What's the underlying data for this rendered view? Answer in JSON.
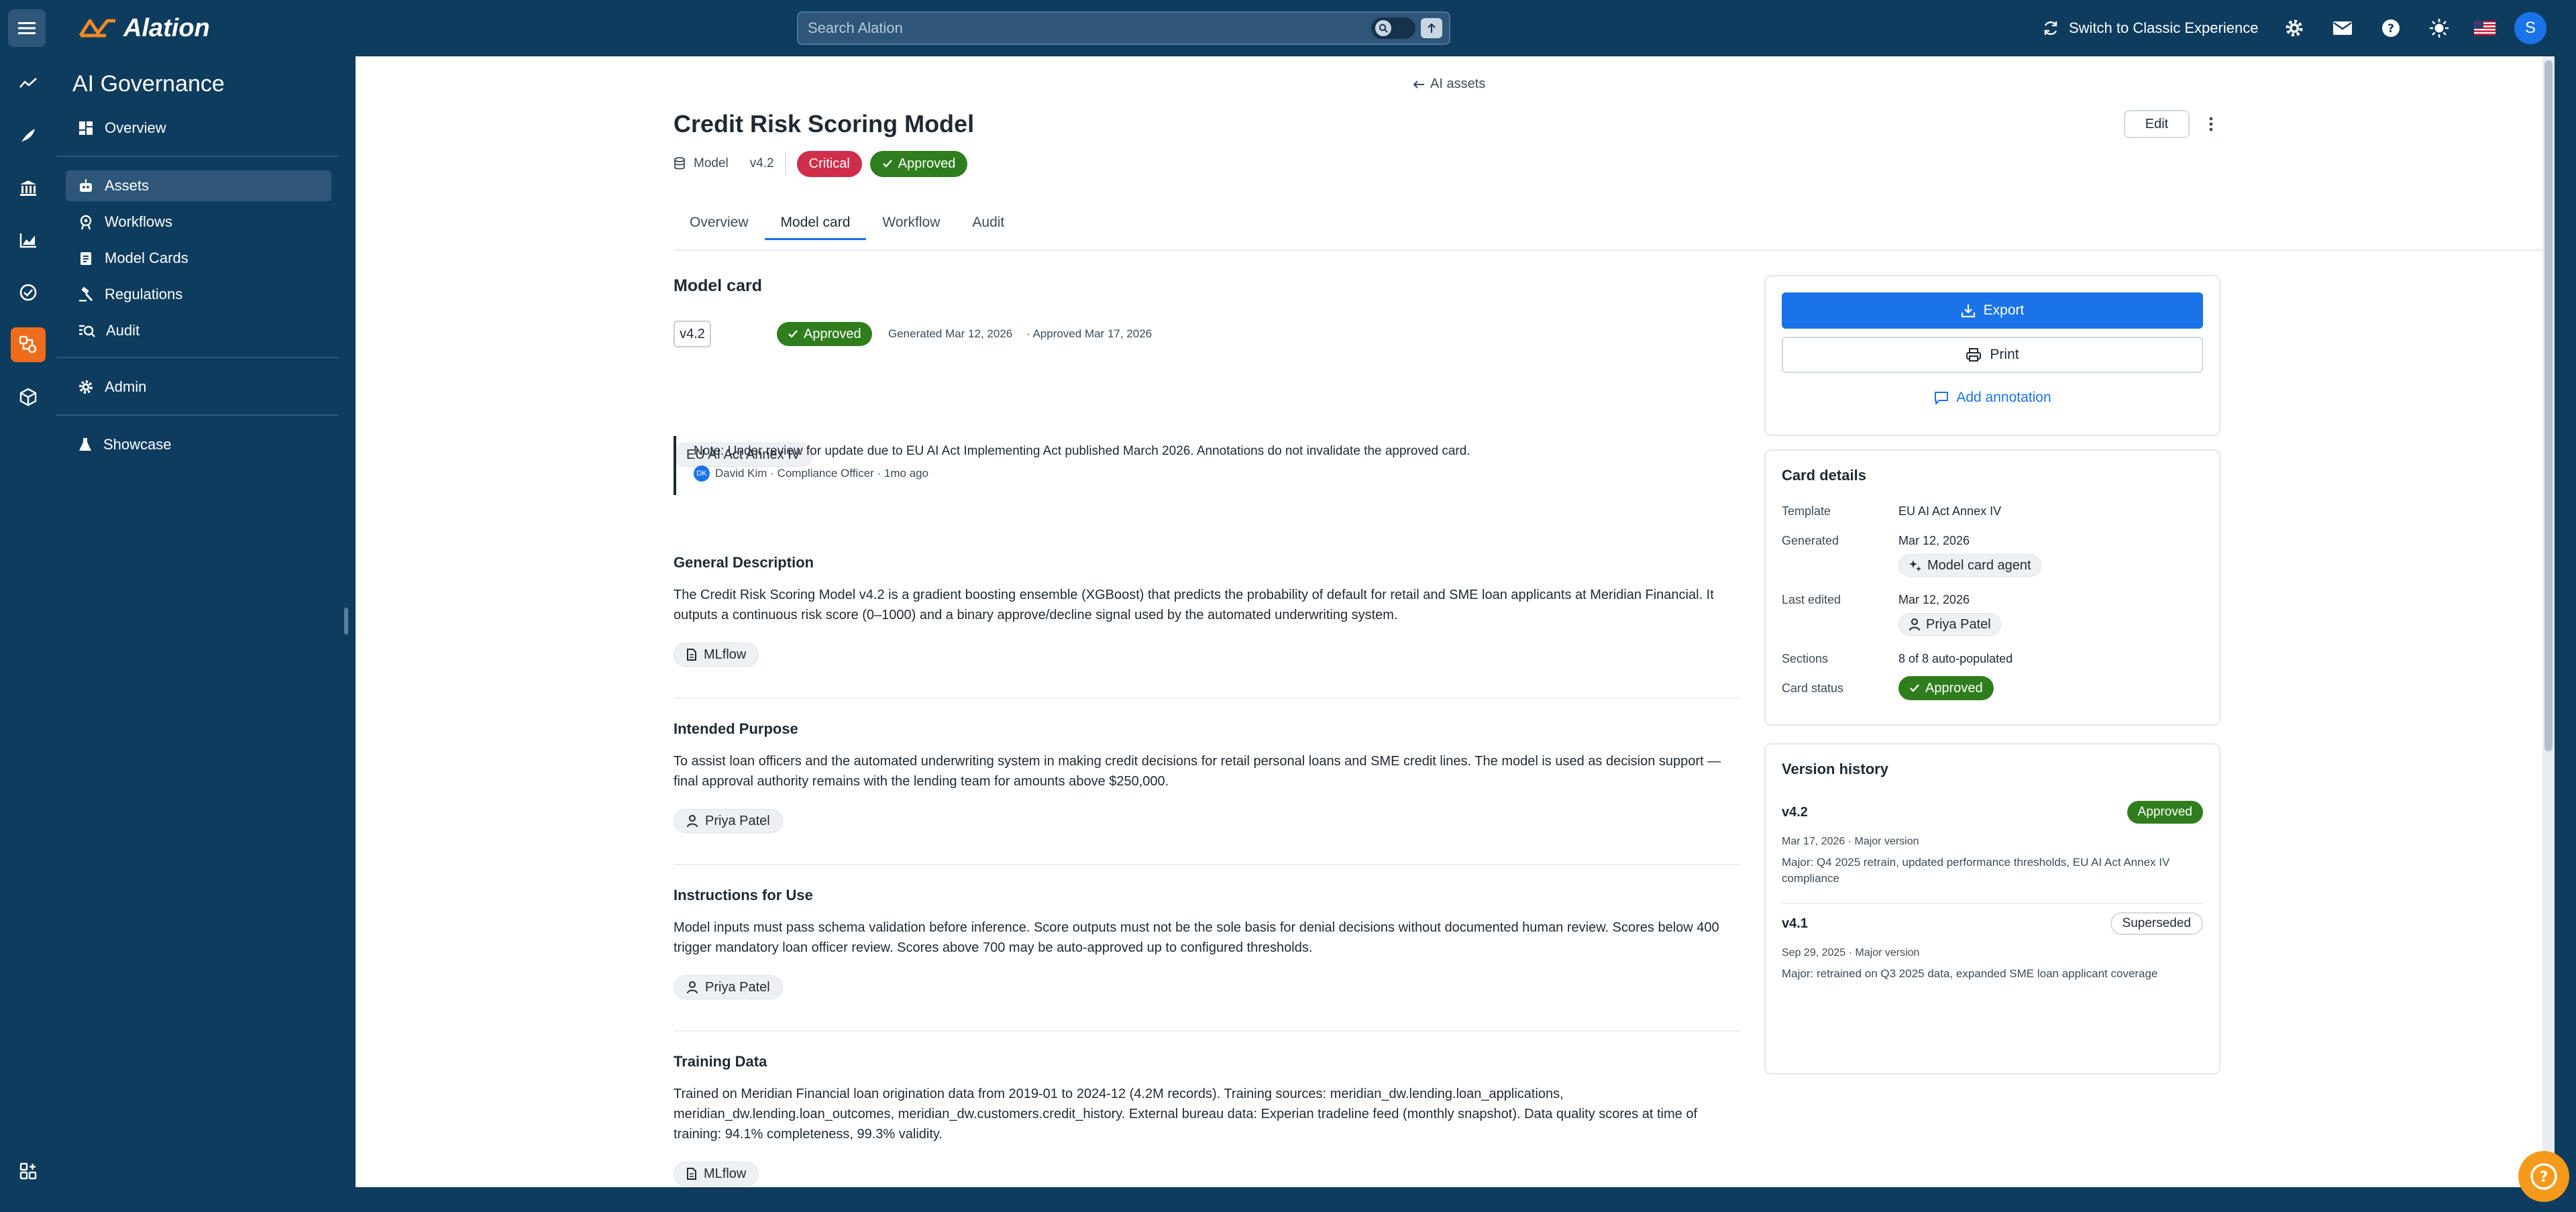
{
  "topbar": {
    "logo": "Alation",
    "search_placeholder": "Search Alation",
    "classic_label": "Switch to Classic Experience",
    "avatar_initial": "S"
  },
  "sidebar": {
    "title": "AI Governance",
    "items": [
      {
        "label": "Overview",
        "icon": "dashboard-icon"
      },
      {
        "label": "Assets",
        "icon": "robot-icon",
        "active": true
      },
      {
        "label": "Workflows",
        "icon": "workflow-icon"
      },
      {
        "label": "Model Cards",
        "icon": "clipboard-icon"
      },
      {
        "label": "Regulations",
        "icon": "gavel-icon"
      },
      {
        "label": "Audit",
        "icon": "audit-search-icon"
      },
      {
        "label": "Admin",
        "icon": "gear-icon"
      },
      {
        "label": "Showcase",
        "icon": "flask-icon"
      }
    ]
  },
  "page": {
    "back_label": "AI assets",
    "title": "Credit Risk Scoring Model",
    "type_label": "Model",
    "version": "v4.2",
    "criticality": "Critical",
    "status": "Approved",
    "edit_label": "Edit",
    "tabs": [
      "Overview",
      "Model card",
      "Workflow",
      "Audit"
    ],
    "active_tab": "Model card"
  },
  "model_card": {
    "heading": "Model card",
    "version": "v4.2",
    "status": "Approved",
    "generated": "Generated Mar 12, 2026",
    "approved": "· Approved Mar 17, 2026",
    "template_tag": "EU AI Act Annex IV",
    "note_text": "Note: Under review for update due to EU AI Act Implementing Act published March 2026. Annotations do not invalidate the approved card.",
    "note_initials": "DK",
    "note_author": "David Kim · Compliance Officer · 1mo ago",
    "sections": [
      {
        "title": "General Description",
        "text": "The Credit Risk Scoring Model v4.2 is a gradient boosting ensemble (XGBoost) that predicts the probability of default for retail and SME loan applicants at Meridian Financial. It outputs a continuous risk score (0–1000) and a binary approve/decline signal used by the automated underwriting system.",
        "source": "MLflow",
        "source_icon": "document-icon"
      },
      {
        "title": "Intended Purpose",
        "text": "To assist loan officers and the automated underwriting system in making credit decisions for retail personal loans and SME credit lines. The model is used as decision support — final approval authority remains with the lending team for amounts above $250,000.",
        "source": "Priya Patel",
        "source_icon": "person-icon"
      },
      {
        "title": "Instructions for Use",
        "text": "Model inputs must pass schema validation before inference. Score outputs must not be the sole basis for denial decisions without documented human review. Scores below 400 trigger mandatory loan officer review. Scores above 700 may be auto-approved up to configured thresholds.",
        "source": "Priya Patel",
        "source_icon": "person-icon"
      },
      {
        "title": "Training Data",
        "text": "Trained on Meridian Financial loan origination data from 2019-01 to 2024-12 (4.2M records). Training sources: meridian_dw.lending.loan_applications, meridian_dw.lending.loan_outcomes, meridian_dw.customers.credit_history. External bureau data: Experian tradeline feed (monthly snapshot). Data quality scores at time of training: 94.1% completeness, 99.3% validity.",
        "source": "MLflow",
        "source_icon": "document-icon"
      }
    ]
  },
  "actions": {
    "export_label": "Export",
    "print_label": "Print",
    "annotate_label": "Add annotation"
  },
  "card_details": {
    "heading": "Card details",
    "template_label": "Template",
    "template_value": "EU AI Act Annex IV",
    "generated_label": "Generated",
    "generated_value": "Mar 12, 2026",
    "generated_by": "Model card agent",
    "edited_label": "Last edited",
    "edited_value": "Mar 12, 2026",
    "edited_by": "Priya Patel",
    "sections_label": "Sections",
    "sections_value": "8 of 8 auto-populated",
    "status_label": "Card status",
    "status_value": "Approved"
  },
  "version_history": {
    "heading": "Version history",
    "versions": [
      {
        "version": "v4.2",
        "status": "Approved",
        "meta": "Mar 17, 2026 · Major version",
        "desc": "Major: Q4 2025 retrain, updated performance thresholds, EU AI Act Annex IV compliance"
      },
      {
        "version": "v4.1",
        "status": "Superseded",
        "meta": "Sep 29, 2025 · Major version",
        "desc": "Major: retrained on Q3 2025 data, expanded SME loan applicant coverage"
      }
    ]
  },
  "colors": {
    "brand_navy": "#0e3c5e",
    "accent_orange": "#ef6c1c",
    "primary_blue": "#1a73e8",
    "approved_green": "#2f7d1d",
    "critical_red": "#cf2e4a"
  }
}
